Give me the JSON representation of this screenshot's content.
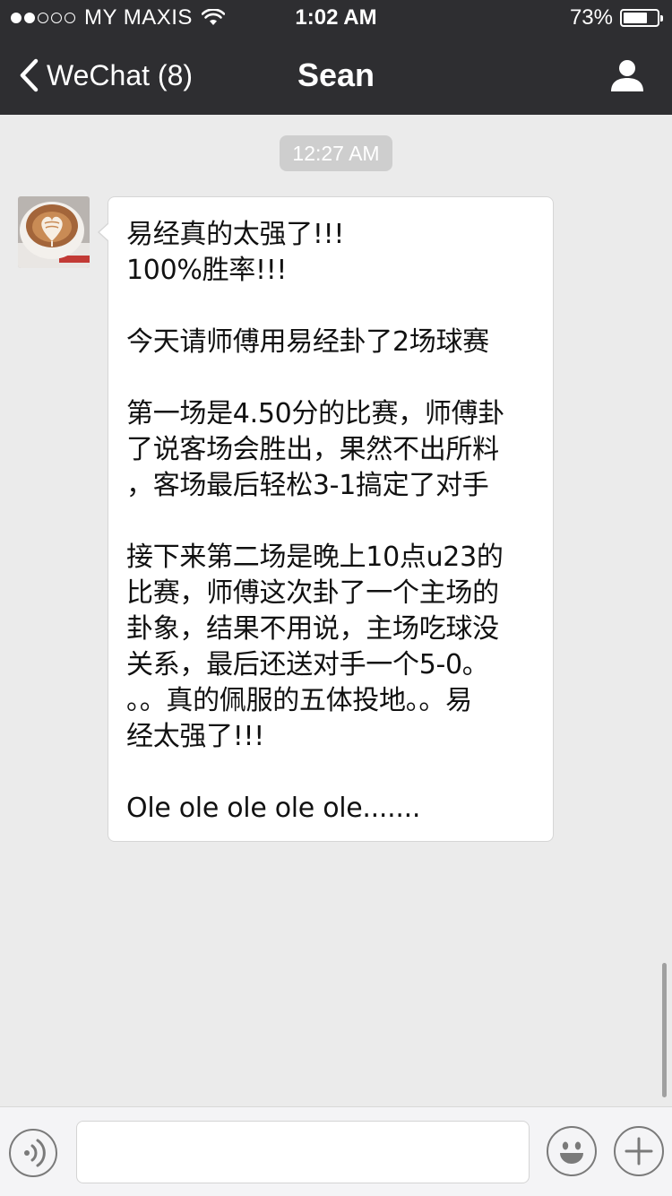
{
  "status_bar": {
    "signal_filled": 2,
    "signal_total": 5,
    "carrier": "MY MAXIS",
    "time": "1:02 AM",
    "battery_percent_text": "73%",
    "battery_level": 0.73
  },
  "nav": {
    "back_label": "WeChat (8)",
    "title": "Sean",
    "profile_icon": "person-icon"
  },
  "chat": {
    "timestamp": "12:27 AM",
    "message": {
      "lines": [
        "易经真的太强了!!!",
        "100%胜率!!!",
        "",
        "今天请师傅用易经卦了2场球赛",
        "",
        "第一场是4.50分的比赛，师傅卦",
        "了说客场会胜出，果然不出所料",
        "，客场最后轻松3-1搞定了对手",
        "",
        "接下来第二场是晚上10点u23的",
        "比赛，师傅这次卦了一个主场的",
        "卦象，结果不用说，主场吃球没",
        "关系，最后还送对手一个5-0。",
        "。。真的佩服的五体投地。。易",
        "经太强了!!!",
        "",
        "Ole ole ole ole ole......."
      ]
    }
  },
  "input_bar": {
    "voice_icon": "voice-icon",
    "input_value": "",
    "emoji_icon": "emoji-icon",
    "plus_icon": "plus-icon"
  },
  "colors": {
    "header_bg": "#2e2e31",
    "chat_bg": "#ebebeb",
    "bubble_bg": "#ffffff",
    "timestamp_bg": "#cecece"
  }
}
